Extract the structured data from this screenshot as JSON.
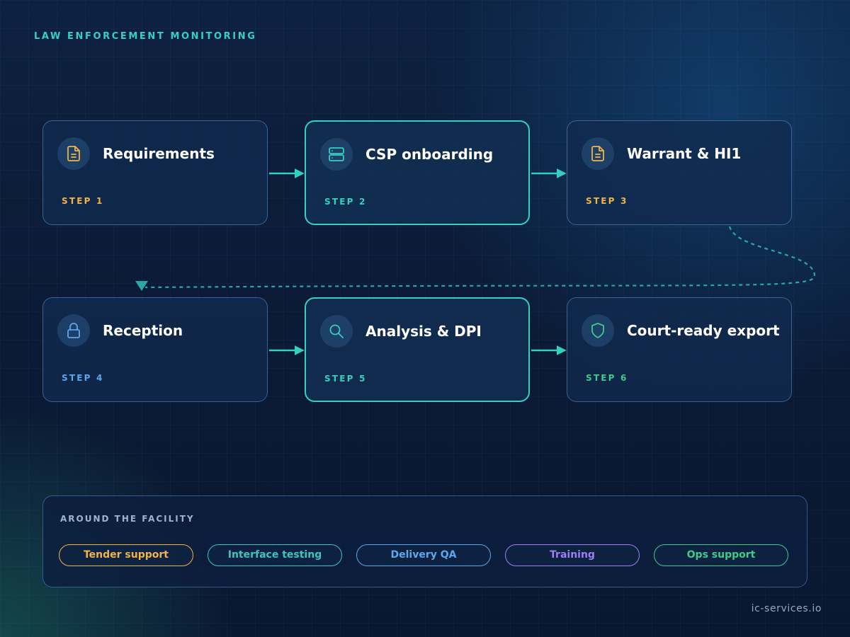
{
  "header": {
    "eyebrow": "LAW ENFORCEMENT MONITORING"
  },
  "steps": [
    {
      "title": "Requirements",
      "step": "STEP 1",
      "icon": "document-icon",
      "accent": "#f0b545",
      "active": false
    },
    {
      "title": "CSP onboarding",
      "step": "STEP 2",
      "icon": "server-icon",
      "accent": "#35cfc2",
      "active": true
    },
    {
      "title": "Warrant & HI1",
      "step": "STEP 3",
      "icon": "document-icon",
      "accent": "#f0b545",
      "active": false
    },
    {
      "title": "Reception",
      "step": "STEP 4",
      "icon": "lock-icon",
      "accent": "#5aa8ee",
      "active": false
    },
    {
      "title": "Analysis & DPI",
      "step": "STEP 5",
      "icon": "search-icon",
      "accent": "#35cfc2",
      "active": true
    },
    {
      "title": "Court-ready export",
      "step": "STEP 6",
      "icon": "shield-icon",
      "accent": "#3dcc8c",
      "active": false
    }
  ],
  "facility": {
    "label": "AROUND THE FACILITY",
    "chips": [
      {
        "label": "Tender support",
        "color": "#f0b545"
      },
      {
        "label": "Interface testing",
        "color": "#3bc6bd"
      },
      {
        "label": "Delivery QA",
        "color": "#5aa8ee"
      },
      {
        "label": "Training",
        "color": "#9a80f0"
      },
      {
        "label": "Ops support",
        "color": "#3dcc8c"
      }
    ]
  },
  "footer": {
    "link": "ic-services.io"
  },
  "colors": {
    "connector": "#35cfc2",
    "card_border": "#4e80b8",
    "background": "#0b1a33"
  }
}
